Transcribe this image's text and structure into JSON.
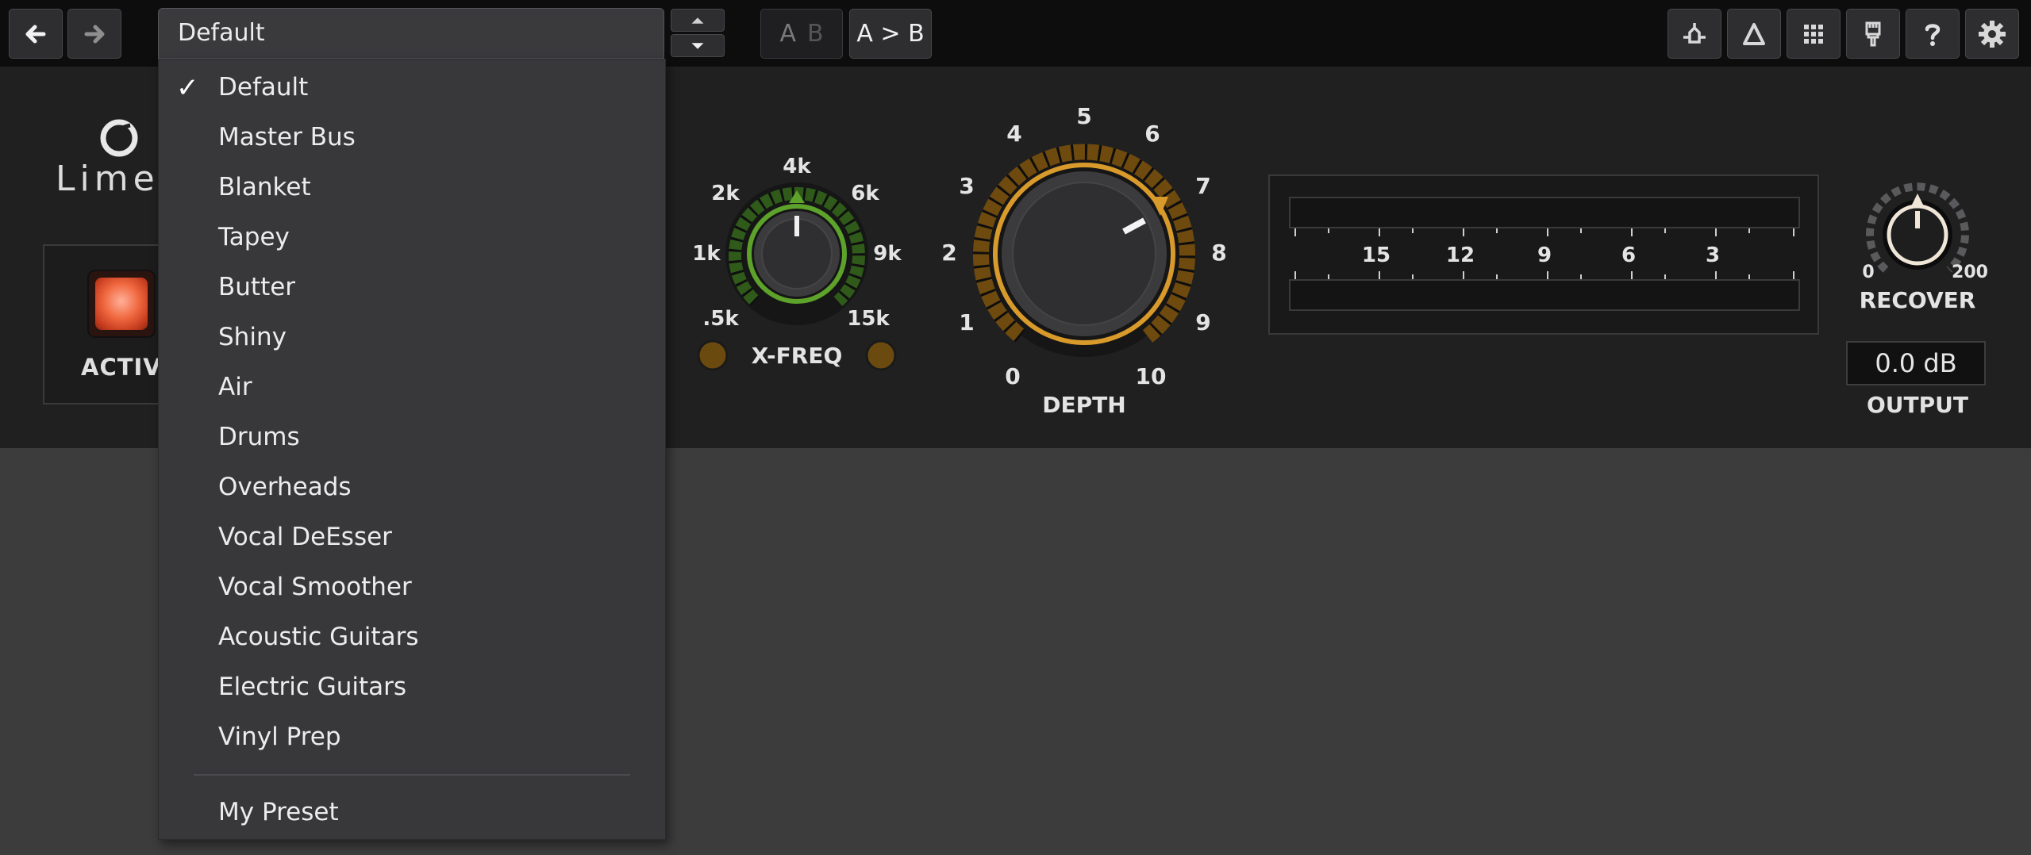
{
  "toolbar": {
    "preset_value": "Default",
    "ab_label_a": "A",
    "ab_label_b": "B",
    "copy_label": "A > B",
    "icons": [
      "back-arrow-icon",
      "forward-arrow-icon",
      "preset-up-icon",
      "preset-down-icon",
      "undo-shield-icon",
      "delta-icon",
      "grid-icon",
      "paintbrush-icon",
      "help-icon",
      "gear-icon"
    ]
  },
  "brand": {
    "name": "Lime"
  },
  "active": {
    "label": "ACTIVE",
    "color": "#f0683f"
  },
  "xfreq": {
    "label": "X-FREQ",
    "ticks": {
      "k05": ".5k",
      "k1": "1k",
      "k2": "2k",
      "k4": "4k",
      "k6": "6k",
      "k9": "9k",
      "k15": "15k"
    },
    "value": "4k",
    "accent": "#5da22a"
  },
  "depth": {
    "label": "DEPTH",
    "ticks": {
      "t0": "0",
      "t1": "1",
      "t2": "2",
      "t3": "3",
      "t4": "4",
      "t5": "5",
      "t6": "6",
      "t7": "7",
      "t8": "8",
      "t9": "9",
      "t10": "10"
    },
    "value": 7.5,
    "accent": "#d89a2a"
  },
  "meter": {
    "scale": {
      "s15": "15",
      "s12": "12",
      "s9": "9",
      "s6": "6",
      "s3": "3"
    }
  },
  "recover": {
    "label": "RECOVER",
    "min": "0",
    "max": "200"
  },
  "output": {
    "value": "0.0 dB",
    "label": "OUTPUT"
  },
  "preset_menu": {
    "items": [
      {
        "label": "Default",
        "checked": true
      },
      {
        "label": "Master Bus"
      },
      {
        "label": "Blanket"
      },
      {
        "label": "Tapey"
      },
      {
        "label": "Butter"
      },
      {
        "label": "Shiny"
      },
      {
        "label": "Air"
      },
      {
        "label": "Drums"
      },
      {
        "label": "Overheads"
      },
      {
        "label": "Vocal DeEsser"
      },
      {
        "label": "Vocal Smoother"
      },
      {
        "label": "Acoustic Guitars"
      },
      {
        "label": "Electric Guitars"
      },
      {
        "label": "Vinyl Prep"
      }
    ],
    "user_items": [
      {
        "label": "My Preset"
      }
    ],
    "check_glyph": "✓"
  }
}
